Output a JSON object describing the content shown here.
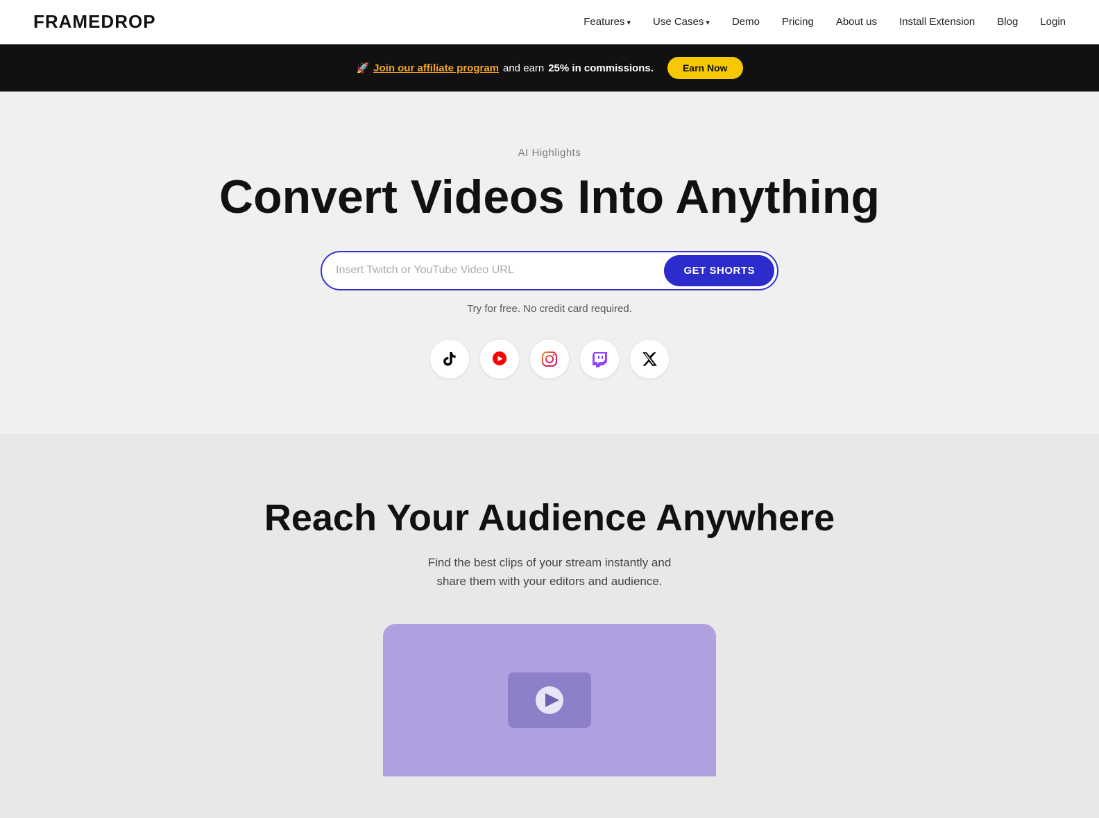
{
  "logo": {
    "text": "FRAMEDROP"
  },
  "nav": {
    "items": [
      {
        "label": "Features",
        "hasArrow": true,
        "name": "features"
      },
      {
        "label": "Use Cases",
        "hasArrow": true,
        "name": "use-cases"
      },
      {
        "label": "Demo",
        "hasArrow": false,
        "name": "demo"
      },
      {
        "label": "Pricing",
        "hasArrow": false,
        "name": "pricing"
      },
      {
        "label": "About us",
        "hasArrow": false,
        "name": "about-us"
      },
      {
        "label": "Install Extension",
        "hasArrow": false,
        "name": "install-extension"
      },
      {
        "label": "Blog",
        "hasArrow": false,
        "name": "blog"
      },
      {
        "label": "Login",
        "hasArrow": false,
        "name": "login"
      }
    ]
  },
  "banner": {
    "rocket_emoji": "🚀",
    "affiliate_text": "Join our affiliate program",
    "middle_text": "and earn",
    "bold_text": "25% in commissions.",
    "button_label": "Earn Now"
  },
  "hero": {
    "label": "AI Highlights",
    "title": "Convert Videos Into Anything",
    "input_placeholder": "Insert Twitch or YouTube Video URL",
    "button_label": "GET SHORTS",
    "subtext": "Try for free. No credit card required.",
    "social_icons": [
      {
        "name": "tiktok",
        "symbol": "♪",
        "color": "#000"
      },
      {
        "name": "youtube-shorts",
        "symbol": "▶",
        "color": "#ff0000"
      },
      {
        "name": "instagram",
        "symbol": "◎",
        "color": "#c13584"
      },
      {
        "name": "twitch",
        "symbol": "◈",
        "color": "#9146ff"
      },
      {
        "name": "x-twitter",
        "symbol": "✕",
        "color": "#000"
      }
    ]
  },
  "section2": {
    "title": "Reach Your Audience Anywhere",
    "desc_line1": "Find the best clips of your stream instantly and",
    "desc_line2": "share them with your editors and audience."
  }
}
